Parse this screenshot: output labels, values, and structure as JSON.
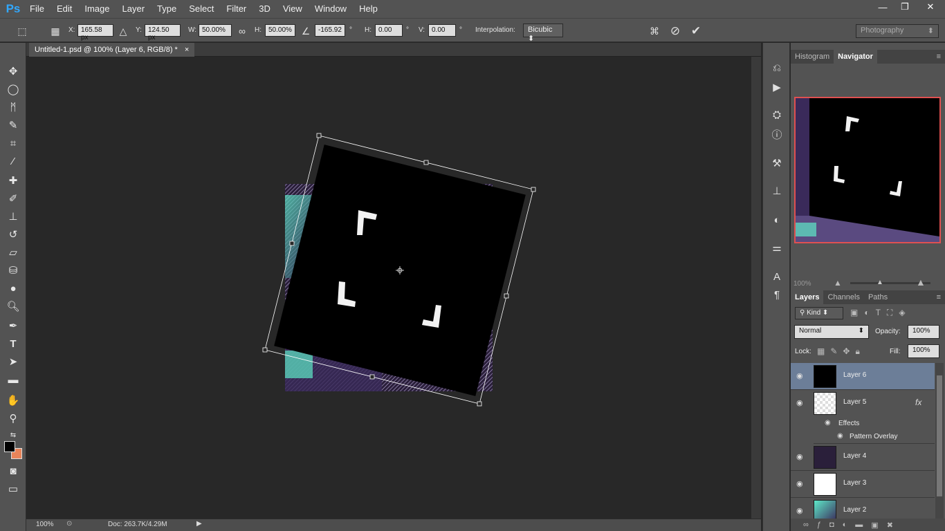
{
  "app": {
    "logo": "Ps"
  },
  "menu": [
    "File",
    "Edit",
    "Image",
    "Layer",
    "Type",
    "Select",
    "Filter",
    "3D",
    "View",
    "Window",
    "Help"
  ],
  "window_controls": {
    "minimize": "—",
    "restore": "❐",
    "close": "✕"
  },
  "options": {
    "x_label": "X:",
    "x_value": "165.58 px",
    "y_label": "Y:",
    "y_value": "124.50 px",
    "w_label": "W:",
    "w_value": "50.00%",
    "h_label": "H:",
    "h_value": "50.00%",
    "angle_value": "-165.92",
    "deg": "°",
    "hskew_label": "H:",
    "hskew_value": "0.00",
    "vskew_label": "V:",
    "vskew_value": "0.00",
    "interp_label": "Interpolation:",
    "interp_value": "Bicubic",
    "workspace": "Photography"
  },
  "document": {
    "tab_title": "Untitled-1.psd @ 100% (Layer 6, RGB/8) *",
    "tab_close": "×"
  },
  "status": {
    "zoom": "100%",
    "doc": "Doc: 263.7K/4.29M"
  },
  "navigator": {
    "tabs": [
      "Histogram",
      "Navigator"
    ],
    "zoom": "100%"
  },
  "layers_panel": {
    "tabs": [
      "Layers",
      "Channels",
      "Paths"
    ],
    "kind": "Kind",
    "blend_mode": "Normal",
    "opacity_label": "Opacity:",
    "opacity_value": "100%",
    "lock_label": "Lock:",
    "fill_label": "Fill:",
    "fill_value": "100%",
    "layers": [
      {
        "name": "Layer 6",
        "selected": true
      },
      {
        "name": "Layer 5",
        "fx": "fx"
      },
      {
        "name": "Effects"
      },
      {
        "name": "Pattern Overlay"
      },
      {
        "name": "Layer 4"
      },
      {
        "name": "Layer 3"
      },
      {
        "name": "Layer 2"
      }
    ]
  },
  "colors": {
    "accent_selected": "#6c7e98",
    "bounding_box": "#ffffff",
    "bg_color_swatch": "#e8845a"
  }
}
